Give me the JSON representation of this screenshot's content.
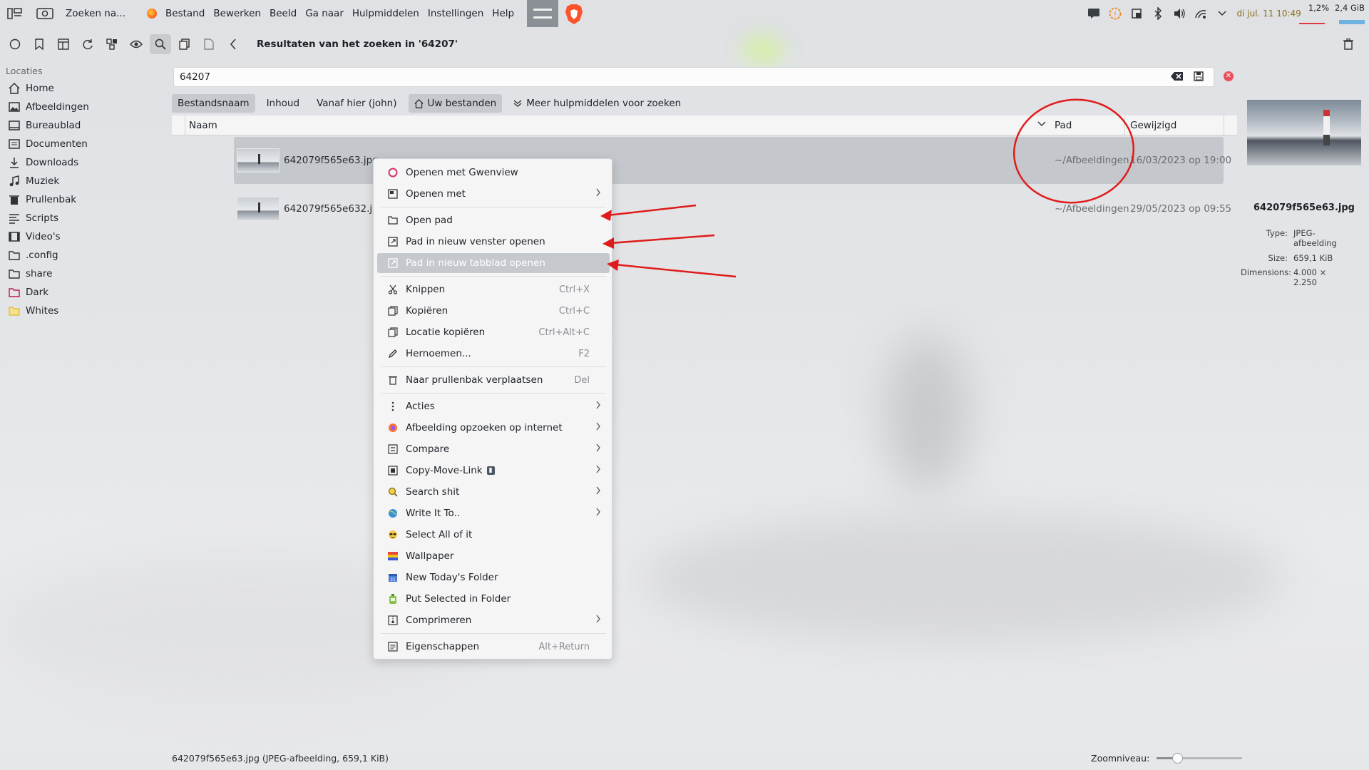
{
  "menubar": {
    "app_title": "Zoeken na...",
    "menus": [
      "Bestand",
      "Bewerken",
      "Beeld",
      "Ga naar",
      "Hulpmiddelen",
      "Instellingen",
      "Help"
    ],
    "clock": "di jul. 11 10:49",
    "cpu": "1,2%",
    "memory": "2,4 GiB"
  },
  "toolbar": {
    "title": "Resultaten van het zoeken in '64207'"
  },
  "sidebar": {
    "heading": "Locaties",
    "items": [
      {
        "label": "Home",
        "icon": "home-icon"
      },
      {
        "label": "Afbeeldingen",
        "icon": "image-icon"
      },
      {
        "label": "Bureaublad",
        "icon": "desktop-icon"
      },
      {
        "label": "Documenten",
        "icon": "document-icon"
      },
      {
        "label": "Downloads",
        "icon": "download-icon"
      },
      {
        "label": "Muziek",
        "icon": "music-icon"
      },
      {
        "label": "Prullenbak",
        "icon": "trash-icon"
      },
      {
        "label": "Scripts",
        "icon": "script-icon"
      },
      {
        "label": "Video's",
        "icon": "video-icon"
      },
      {
        "label": ".config",
        "icon": "folder-icon"
      },
      {
        "label": "share",
        "icon": "folder-icon"
      },
      {
        "label": "Dark",
        "icon": "folder-pink-icon"
      },
      {
        "label": "Whites",
        "icon": "folder-yellow-icon"
      }
    ]
  },
  "search": {
    "value": "64207"
  },
  "filters": {
    "filename": "Bestandsnaam",
    "content": "Inhoud",
    "from_here": "Vanaf hier (john)",
    "your_files": "Uw bestanden",
    "more_tools": "Meer hulpmiddelen voor zoeken"
  },
  "columns": {
    "name": "Naam",
    "path": "Pad",
    "modified": "Gewijzigd"
  },
  "files": [
    {
      "name": "642079f565e63.jpg",
      "path": "~/Afbeeldingen",
      "modified": "16/03/2023 op 19:00"
    },
    {
      "name": "642079f565e632.jpg",
      "path": "~/Afbeeldingen",
      "modified": "29/05/2023 op 09:55"
    }
  ],
  "preview": {
    "title": "642079f565e63.jpg",
    "type_label": "Type:",
    "type_value": "JPEG-afbeelding",
    "size_label": "Size:",
    "size_value": "659,1 KiB",
    "dim_label": "Dimensions:",
    "dim_value": "4.000 × 2.250"
  },
  "context_menu": {
    "open_with_gwenview": "Openen met Gwenview",
    "open_with": "Openen met",
    "open_path": "Open pad",
    "open_path_new_window": "Pad in nieuw venster openen",
    "open_path_new_tab": "Pad in nieuw tabblad openen",
    "cut": "Knippen",
    "cut_sc": "Ctrl+X",
    "copy": "Kopiëren",
    "copy_sc": "Ctrl+C",
    "copy_location": "Locatie kopiëren",
    "copy_location_sc": "Ctrl+Alt+C",
    "rename": "Hernoemen...",
    "rename_sc": "F2",
    "move_trash": "Naar prullenbak verplaatsen",
    "move_trash_sc": "Del",
    "actions": "Acties",
    "search_image": "Afbeelding opzoeken op internet",
    "compare": "Compare",
    "copy_move_link": "Copy-Move-Link",
    "search_shit": "Search shit",
    "write_it_to": "Write It To..",
    "select_all": "Select All of it",
    "wallpaper": "Wallpaper",
    "new_today_folder": "New Today's Folder",
    "put_selected": "Put Selected in Folder",
    "compress": "Comprimeren",
    "properties": "Eigenschappen",
    "properties_sc": "Alt+Return"
  },
  "status": {
    "text": "642079f565e63.jpg (JPEG-afbeelding, 659,1 KiB)",
    "zoom_label": "Zoomniveau:",
    "zoom_level": 0.24
  },
  "colors": {
    "annotation": "#e01b1b",
    "selection": "#c4c7cb"
  }
}
